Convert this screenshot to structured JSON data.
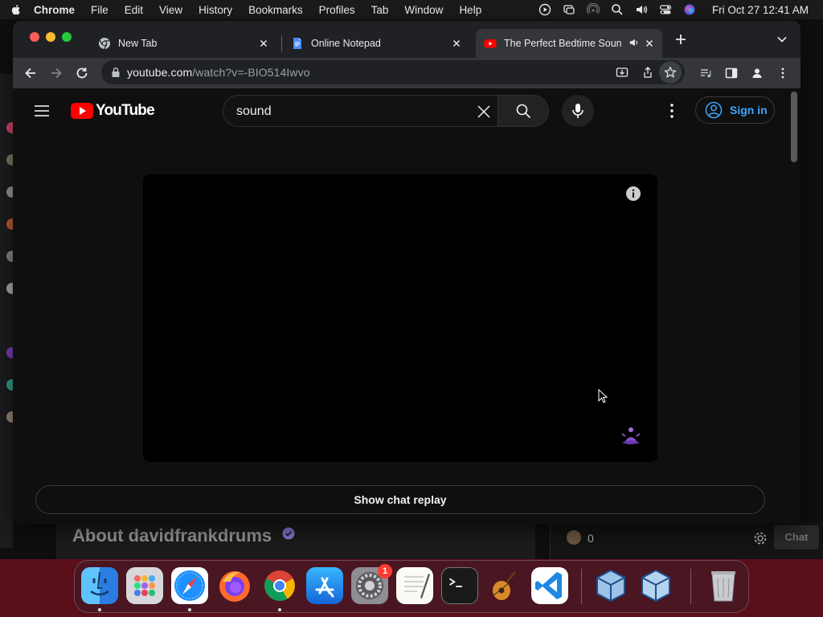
{
  "menubar": {
    "app_name": "Chrome",
    "items": [
      "File",
      "Edit",
      "View",
      "History",
      "Bookmarks",
      "Profiles",
      "Tab",
      "Window",
      "Help"
    ],
    "clock": "Fri Oct 27  12:41 AM"
  },
  "background_window": {
    "about_title": "About davidfrankdrums",
    "viewer_count": "0",
    "chat_button": "Chat"
  },
  "tabs": [
    {
      "title": "New Tab",
      "favicon": "chrome-icon"
    },
    {
      "title": "Online Notepad",
      "favicon": "notepad-doc-icon"
    },
    {
      "title": "The Perfect Bedtime Soun",
      "favicon": "youtube-icon",
      "active": true,
      "audio": true
    }
  ],
  "omnibox": {
    "host": "youtube.com",
    "path": "/watch?v=-BIO514Iwvo"
  },
  "youtube": {
    "logo_text": "YouTube",
    "search_query": "sound",
    "sign_in": "Sign in",
    "show_chat_replay": "Show chat replay"
  },
  "dock": {
    "apps": [
      "Finder",
      "Launchpad",
      "Safari",
      "Firefox",
      "Google Chrome",
      "App Store",
      "System Settings",
      "TextEdit",
      "Terminal",
      "GarageBand",
      "Visual Studio Code",
      "VirtualBox",
      "VirtualBox VM",
      "Trash"
    ],
    "settings_badge": "1"
  },
  "colors": {
    "youtube_red": "#ff0000",
    "link_blue": "#3ea6ff",
    "page_bg": "#0f0f0f",
    "tab_active": "#35363a",
    "tabstrip": "#202124"
  }
}
